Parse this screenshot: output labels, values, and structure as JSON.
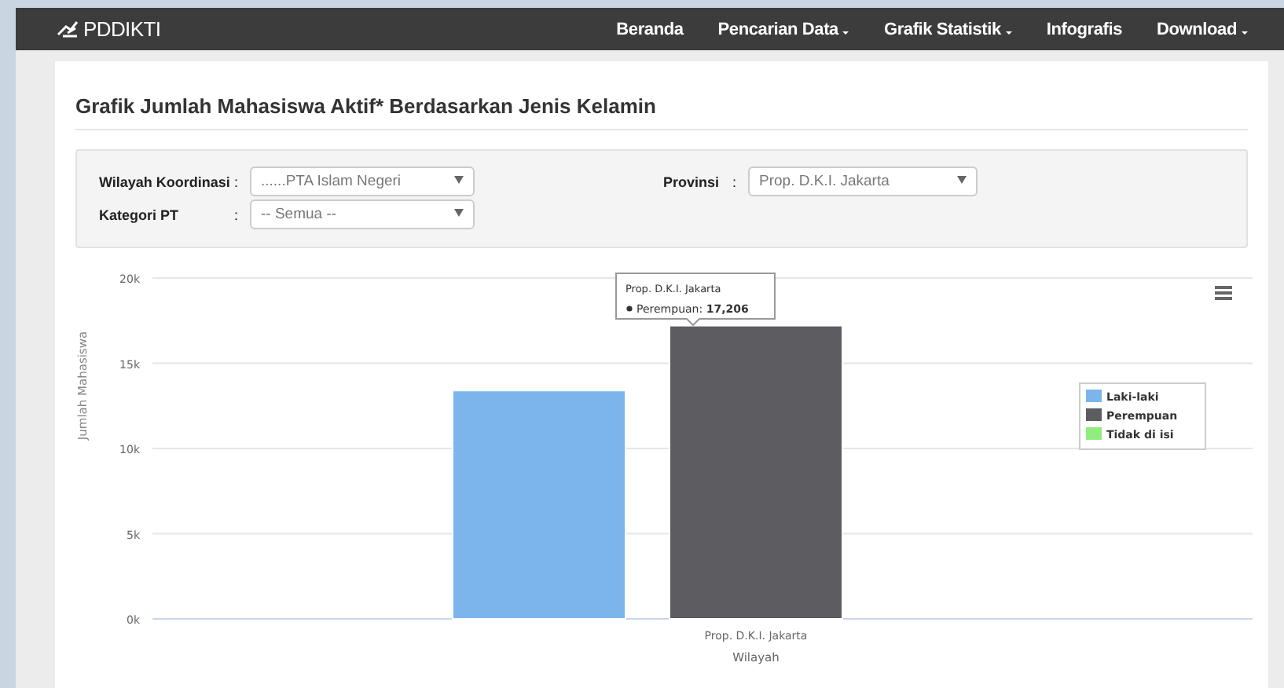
{
  "navbar": {
    "brand": "PDDIKTI",
    "items": [
      {
        "label": "Beranda",
        "dropdown": false
      },
      {
        "label": "Pencarian Data",
        "dropdown": true
      },
      {
        "label": "Grafik Statistik",
        "dropdown": true
      },
      {
        "label": "Infografis",
        "dropdown": false
      },
      {
        "label": "Download",
        "dropdown": true
      }
    ]
  },
  "page_title": "Grafik Jumlah Mahasiswa Aktif* Berdasarkan Jenis Kelamin",
  "filters": {
    "left": [
      {
        "label": "Wilayah Koordinasi",
        "separator": ":",
        "value": "......PTA Islam Negeri"
      },
      {
        "label": "Kategori PT",
        "separator": ":",
        "value": "-- Semua --"
      }
    ],
    "right": [
      {
        "label": "Provinsi",
        "separator": ":",
        "value": "Prop. D.K.I. Jakarta"
      }
    ]
  },
  "chart": {
    "tooltip": {
      "title": "Prop. D.K.I. Jakarta",
      "series": "Perempuan:",
      "value": "17,206"
    },
    "chart_data": {
      "type": "bar",
      "xlabel": "Wilayah",
      "ylabel": "Jumlah Mahasiswa",
      "categories": [
        "Prop. D.K.I. Jakarta"
      ],
      "series": [
        {
          "name": "Laki-laki",
          "color": "#7cb5ec",
          "values": [
            13400
          ]
        },
        {
          "name": "Perempuan",
          "color": "#5c5c61",
          "values": [
            17206
          ]
        },
        {
          "name": "Tidak di isi",
          "color": "#90ed7d",
          "values": [
            0
          ]
        }
      ],
      "ylim": [
        0,
        20000
      ],
      "grid": true,
      "legend": true,
      "yticks": [
        {
          "value": 0,
          "label": "0k"
        },
        {
          "value": 5000,
          "label": "5k"
        },
        {
          "value": 10000,
          "label": "10k"
        },
        {
          "value": 15000,
          "label": "15k"
        },
        {
          "value": 20000,
          "label": "20k"
        }
      ]
    }
  }
}
